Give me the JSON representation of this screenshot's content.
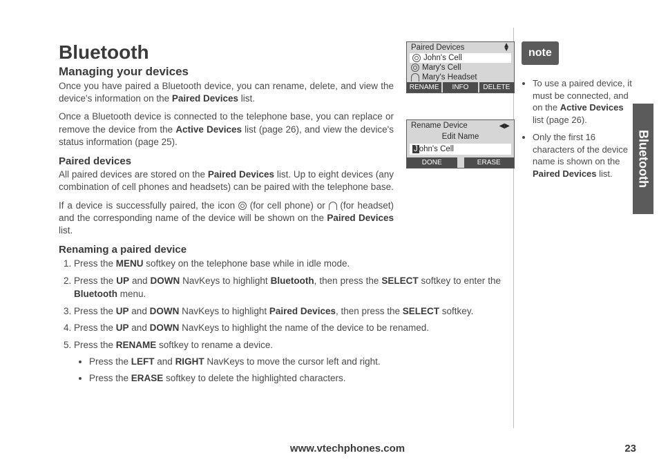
{
  "page": {
    "title": "Bluetooth",
    "subtitle": "Managing your devices",
    "url": "www.vtechphones.com",
    "number": "23",
    "side_tab": "Bluetooth"
  },
  "intro": {
    "p1a": "Once you have paired a Bluetooth device, you can rename, delete, and view the device's information on the ",
    "p1b": "Paired Devices",
    "p1c": " list.",
    "p2a": "Once a Bluetooth device is connected to the telephone base, you can replace or remove the device from the ",
    "p2b": "Active Devices",
    "p2c": " list (page 26), and view the device's status information (page 25)."
  },
  "paired": {
    "heading": "Paired devices",
    "p1a": "All paired devices are stored on the ",
    "p1b": "Paired Devices",
    "p1c": " list. Up to eight devices (any combination of cell phones and headsets) can be paired with the telephone base.",
    "p2a": "If a device is successfully paired, the icon ",
    "p2b": " (for cell phone) or ",
    "p2c": " (for headset) and the corresponding name of the device will be shown on the ",
    "p2d": "Paired Devices",
    "p2e": " list."
  },
  "rename": {
    "heading": "Renaming a paired device",
    "s1a": "Press the ",
    "s1b": "MENU",
    "s1c": " softkey on the telephone base while in idle mode.",
    "s2a": "Press the ",
    "s2b": "UP",
    "s2c": " and ",
    "s2d": "DOWN",
    "s2e": " NavKeys to highlight ",
    "s2f": "Bluetooth",
    "s2g": ", then press the ",
    "s2h": "SELECT",
    "s2i": " softkey to enter the ",
    "s2j": "Bluetooth",
    "s2k": " menu.",
    "s3a": "Press the ",
    "s3b": "UP",
    "s3c": " and ",
    "s3d": "DOWN",
    "s3e": " NavKeys to highlight ",
    "s3f": "Paired Devices",
    "s3g": ", then press the ",
    "s3h": "SELECT",
    "s3i": " softkey.",
    "s4a": "Press the ",
    "s4b": "UP",
    "s4c": " and ",
    "s4d": "DOWN",
    "s4e": " NavKeys to highlight the name of the device to be renamed.",
    "s5a": "Press the ",
    "s5b": "RENAME",
    "s5c": " softkey to rename a device.",
    "b1a": "Press the ",
    "b1b": "LEFT",
    "b1c": " and ",
    "b1d": "RIGHT",
    "b1e": " NavKeys to move the cursor left and right.",
    "b2a": "Press the ",
    "b2b": "ERASE",
    "b2c": " softkey to delete the highlighted characters."
  },
  "lcd1": {
    "title": "Paired Devices",
    "row1": "John's Cell",
    "row2": "Mary's Cell",
    "row3": "Mary's Headset",
    "k1": "RENAME",
    "k2": "INFO",
    "k3": "DELETE"
  },
  "lcd2": {
    "title": "Rename Device",
    "edit_label": "Edit Name",
    "cursor": "J",
    "rest": "ohn's Cell",
    "k1": "DONE",
    "k2": "ERASE"
  },
  "note": {
    "badge": "note",
    "n1a": "To use a paired device, it must be connected, and on the ",
    "n1b": "Active Devices",
    "n1c": " list (page 26).",
    "n2a": "Only the first 16 characters of the device name is shown on the ",
    "n2b": "Paired Devices",
    "n2c": " list."
  }
}
